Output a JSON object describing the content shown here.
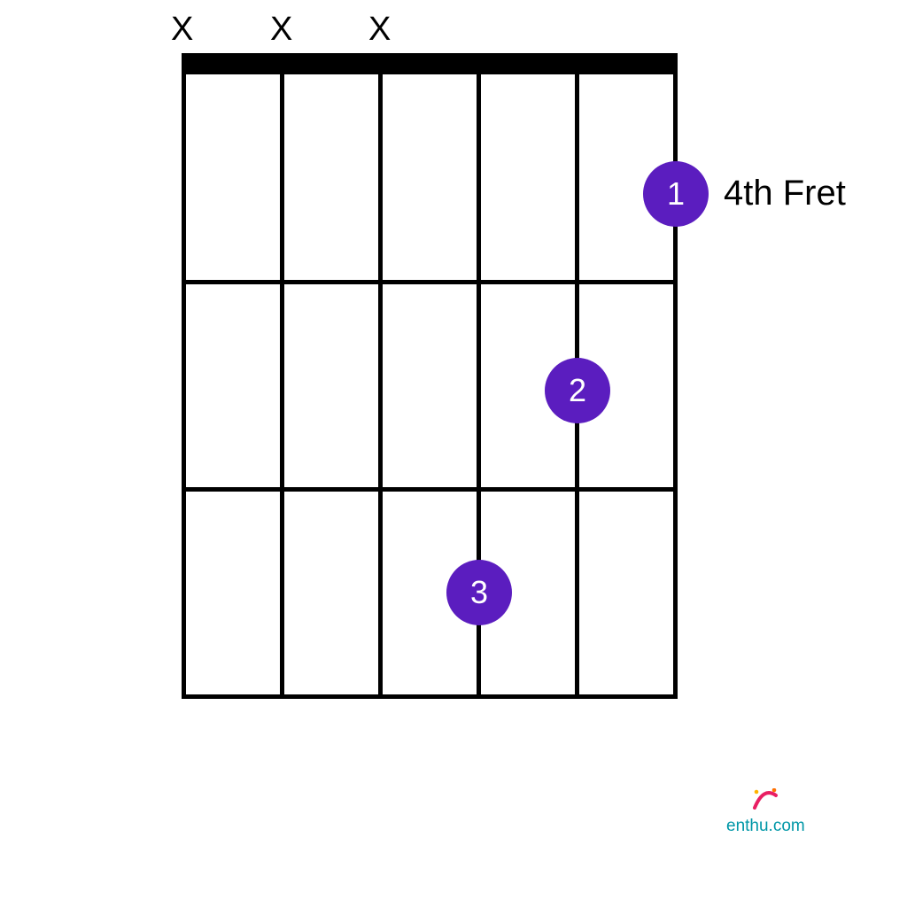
{
  "chart_data": {
    "type": "guitar-chord-diagram",
    "strings": 6,
    "frets_shown": 3,
    "starting_fret": 4,
    "muted_strings": [
      1,
      2,
      3
    ],
    "finger_positions": [
      {
        "finger": 1,
        "string": 6,
        "fret": 1
      },
      {
        "finger": 2,
        "string": 5,
        "fret": 2
      },
      {
        "finger": 3,
        "string": 4,
        "fret": 3
      }
    ],
    "open_strings": []
  },
  "mute_symbol": "X",
  "fret_label": "4th Fret",
  "fingers": {
    "f1": "1",
    "f2": "2",
    "f3": "3"
  },
  "branding": {
    "domain": "enthu.com"
  },
  "colors": {
    "dot": "#5B1DBF",
    "text": "#000000",
    "logo_accent": "#e91e63",
    "logo_text": "#0097a7"
  }
}
